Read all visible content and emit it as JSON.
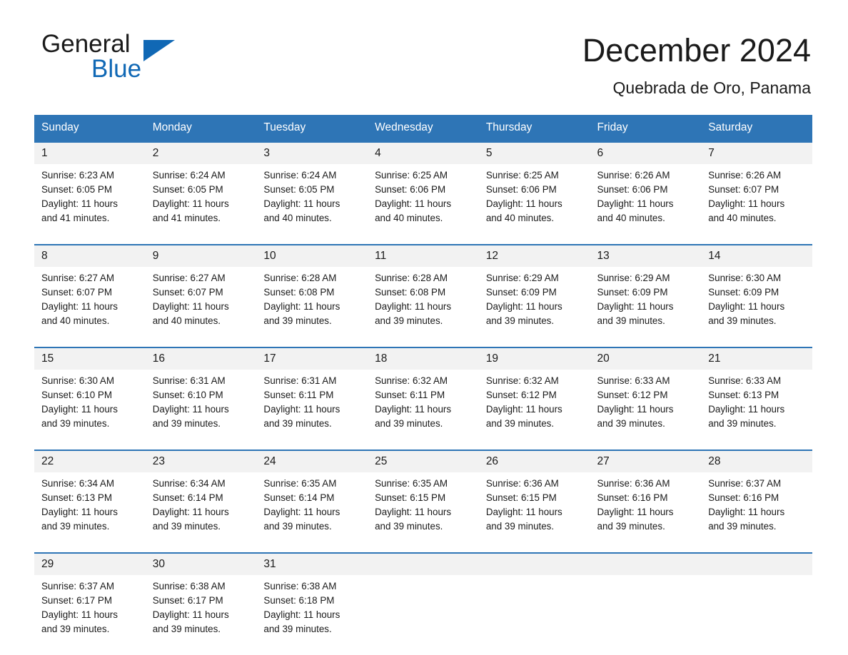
{
  "brand": {
    "name_part1": "General",
    "name_part2": "Blue",
    "triangle_color": "#1068b5"
  },
  "header": {
    "title": "December 2024",
    "subtitle": "Quebrada de Oro, Panama",
    "accent_color": "#2e75b6",
    "daynum_band_color": "#f2f2f2"
  },
  "weekdays": [
    "Sunday",
    "Monday",
    "Tuesday",
    "Wednesday",
    "Thursday",
    "Friday",
    "Saturday"
  ],
  "weeks": [
    {
      "days": [
        {
          "num": "1",
          "sunrise": "Sunrise: 6:23 AM",
          "sunset": "Sunset: 6:05 PM",
          "daylight1": "Daylight: 11 hours",
          "daylight2": "and 41 minutes."
        },
        {
          "num": "2",
          "sunrise": "Sunrise: 6:24 AM",
          "sunset": "Sunset: 6:05 PM",
          "daylight1": "Daylight: 11 hours",
          "daylight2": "and 41 minutes."
        },
        {
          "num": "3",
          "sunrise": "Sunrise: 6:24 AM",
          "sunset": "Sunset: 6:05 PM",
          "daylight1": "Daylight: 11 hours",
          "daylight2": "and 40 minutes."
        },
        {
          "num": "4",
          "sunrise": "Sunrise: 6:25 AM",
          "sunset": "Sunset: 6:06 PM",
          "daylight1": "Daylight: 11 hours",
          "daylight2": "and 40 minutes."
        },
        {
          "num": "5",
          "sunrise": "Sunrise: 6:25 AM",
          "sunset": "Sunset: 6:06 PM",
          "daylight1": "Daylight: 11 hours",
          "daylight2": "and 40 minutes."
        },
        {
          "num": "6",
          "sunrise": "Sunrise: 6:26 AM",
          "sunset": "Sunset: 6:06 PM",
          "daylight1": "Daylight: 11 hours",
          "daylight2": "and 40 minutes."
        },
        {
          "num": "7",
          "sunrise": "Sunrise: 6:26 AM",
          "sunset": "Sunset: 6:07 PM",
          "daylight1": "Daylight: 11 hours",
          "daylight2": "and 40 minutes."
        }
      ]
    },
    {
      "days": [
        {
          "num": "8",
          "sunrise": "Sunrise: 6:27 AM",
          "sunset": "Sunset: 6:07 PM",
          "daylight1": "Daylight: 11 hours",
          "daylight2": "and 40 minutes."
        },
        {
          "num": "9",
          "sunrise": "Sunrise: 6:27 AM",
          "sunset": "Sunset: 6:07 PM",
          "daylight1": "Daylight: 11 hours",
          "daylight2": "and 40 minutes."
        },
        {
          "num": "10",
          "sunrise": "Sunrise: 6:28 AM",
          "sunset": "Sunset: 6:08 PM",
          "daylight1": "Daylight: 11 hours",
          "daylight2": "and 39 minutes."
        },
        {
          "num": "11",
          "sunrise": "Sunrise: 6:28 AM",
          "sunset": "Sunset: 6:08 PM",
          "daylight1": "Daylight: 11 hours",
          "daylight2": "and 39 minutes."
        },
        {
          "num": "12",
          "sunrise": "Sunrise: 6:29 AM",
          "sunset": "Sunset: 6:09 PM",
          "daylight1": "Daylight: 11 hours",
          "daylight2": "and 39 minutes."
        },
        {
          "num": "13",
          "sunrise": "Sunrise: 6:29 AM",
          "sunset": "Sunset: 6:09 PM",
          "daylight1": "Daylight: 11 hours",
          "daylight2": "and 39 minutes."
        },
        {
          "num": "14",
          "sunrise": "Sunrise: 6:30 AM",
          "sunset": "Sunset: 6:09 PM",
          "daylight1": "Daylight: 11 hours",
          "daylight2": "and 39 minutes."
        }
      ]
    },
    {
      "days": [
        {
          "num": "15",
          "sunrise": "Sunrise: 6:30 AM",
          "sunset": "Sunset: 6:10 PM",
          "daylight1": "Daylight: 11 hours",
          "daylight2": "and 39 minutes."
        },
        {
          "num": "16",
          "sunrise": "Sunrise: 6:31 AM",
          "sunset": "Sunset: 6:10 PM",
          "daylight1": "Daylight: 11 hours",
          "daylight2": "and 39 minutes."
        },
        {
          "num": "17",
          "sunrise": "Sunrise: 6:31 AM",
          "sunset": "Sunset: 6:11 PM",
          "daylight1": "Daylight: 11 hours",
          "daylight2": "and 39 minutes."
        },
        {
          "num": "18",
          "sunrise": "Sunrise: 6:32 AM",
          "sunset": "Sunset: 6:11 PM",
          "daylight1": "Daylight: 11 hours",
          "daylight2": "and 39 minutes."
        },
        {
          "num": "19",
          "sunrise": "Sunrise: 6:32 AM",
          "sunset": "Sunset: 6:12 PM",
          "daylight1": "Daylight: 11 hours",
          "daylight2": "and 39 minutes."
        },
        {
          "num": "20",
          "sunrise": "Sunrise: 6:33 AM",
          "sunset": "Sunset: 6:12 PM",
          "daylight1": "Daylight: 11 hours",
          "daylight2": "and 39 minutes."
        },
        {
          "num": "21",
          "sunrise": "Sunrise: 6:33 AM",
          "sunset": "Sunset: 6:13 PM",
          "daylight1": "Daylight: 11 hours",
          "daylight2": "and 39 minutes."
        }
      ]
    },
    {
      "days": [
        {
          "num": "22",
          "sunrise": "Sunrise: 6:34 AM",
          "sunset": "Sunset: 6:13 PM",
          "daylight1": "Daylight: 11 hours",
          "daylight2": "and 39 minutes."
        },
        {
          "num": "23",
          "sunrise": "Sunrise: 6:34 AM",
          "sunset": "Sunset: 6:14 PM",
          "daylight1": "Daylight: 11 hours",
          "daylight2": "and 39 minutes."
        },
        {
          "num": "24",
          "sunrise": "Sunrise: 6:35 AM",
          "sunset": "Sunset: 6:14 PM",
          "daylight1": "Daylight: 11 hours",
          "daylight2": "and 39 minutes."
        },
        {
          "num": "25",
          "sunrise": "Sunrise: 6:35 AM",
          "sunset": "Sunset: 6:15 PM",
          "daylight1": "Daylight: 11 hours",
          "daylight2": "and 39 minutes."
        },
        {
          "num": "26",
          "sunrise": "Sunrise: 6:36 AM",
          "sunset": "Sunset: 6:15 PM",
          "daylight1": "Daylight: 11 hours",
          "daylight2": "and 39 minutes."
        },
        {
          "num": "27",
          "sunrise": "Sunrise: 6:36 AM",
          "sunset": "Sunset: 6:16 PM",
          "daylight1": "Daylight: 11 hours",
          "daylight2": "and 39 minutes."
        },
        {
          "num": "28",
          "sunrise": "Sunrise: 6:37 AM",
          "sunset": "Sunset: 6:16 PM",
          "daylight1": "Daylight: 11 hours",
          "daylight2": "and 39 minutes."
        }
      ]
    },
    {
      "days": [
        {
          "num": "29",
          "sunrise": "Sunrise: 6:37 AM",
          "sunset": "Sunset: 6:17 PM",
          "daylight1": "Daylight: 11 hours",
          "daylight2": "and 39 minutes."
        },
        {
          "num": "30",
          "sunrise": "Sunrise: 6:38 AM",
          "sunset": "Sunset: 6:17 PM",
          "daylight1": "Daylight: 11 hours",
          "daylight2": "and 39 minutes."
        },
        {
          "num": "31",
          "sunrise": "Sunrise: 6:38 AM",
          "sunset": "Sunset: 6:18 PM",
          "daylight1": "Daylight: 11 hours",
          "daylight2": "and 39 minutes."
        },
        {
          "num": "",
          "sunrise": "",
          "sunset": "",
          "daylight1": "",
          "daylight2": ""
        },
        {
          "num": "",
          "sunrise": "",
          "sunset": "",
          "daylight1": "",
          "daylight2": ""
        },
        {
          "num": "",
          "sunrise": "",
          "sunset": "",
          "daylight1": "",
          "daylight2": ""
        },
        {
          "num": "",
          "sunrise": "",
          "sunset": "",
          "daylight1": "",
          "daylight2": ""
        }
      ]
    }
  ]
}
